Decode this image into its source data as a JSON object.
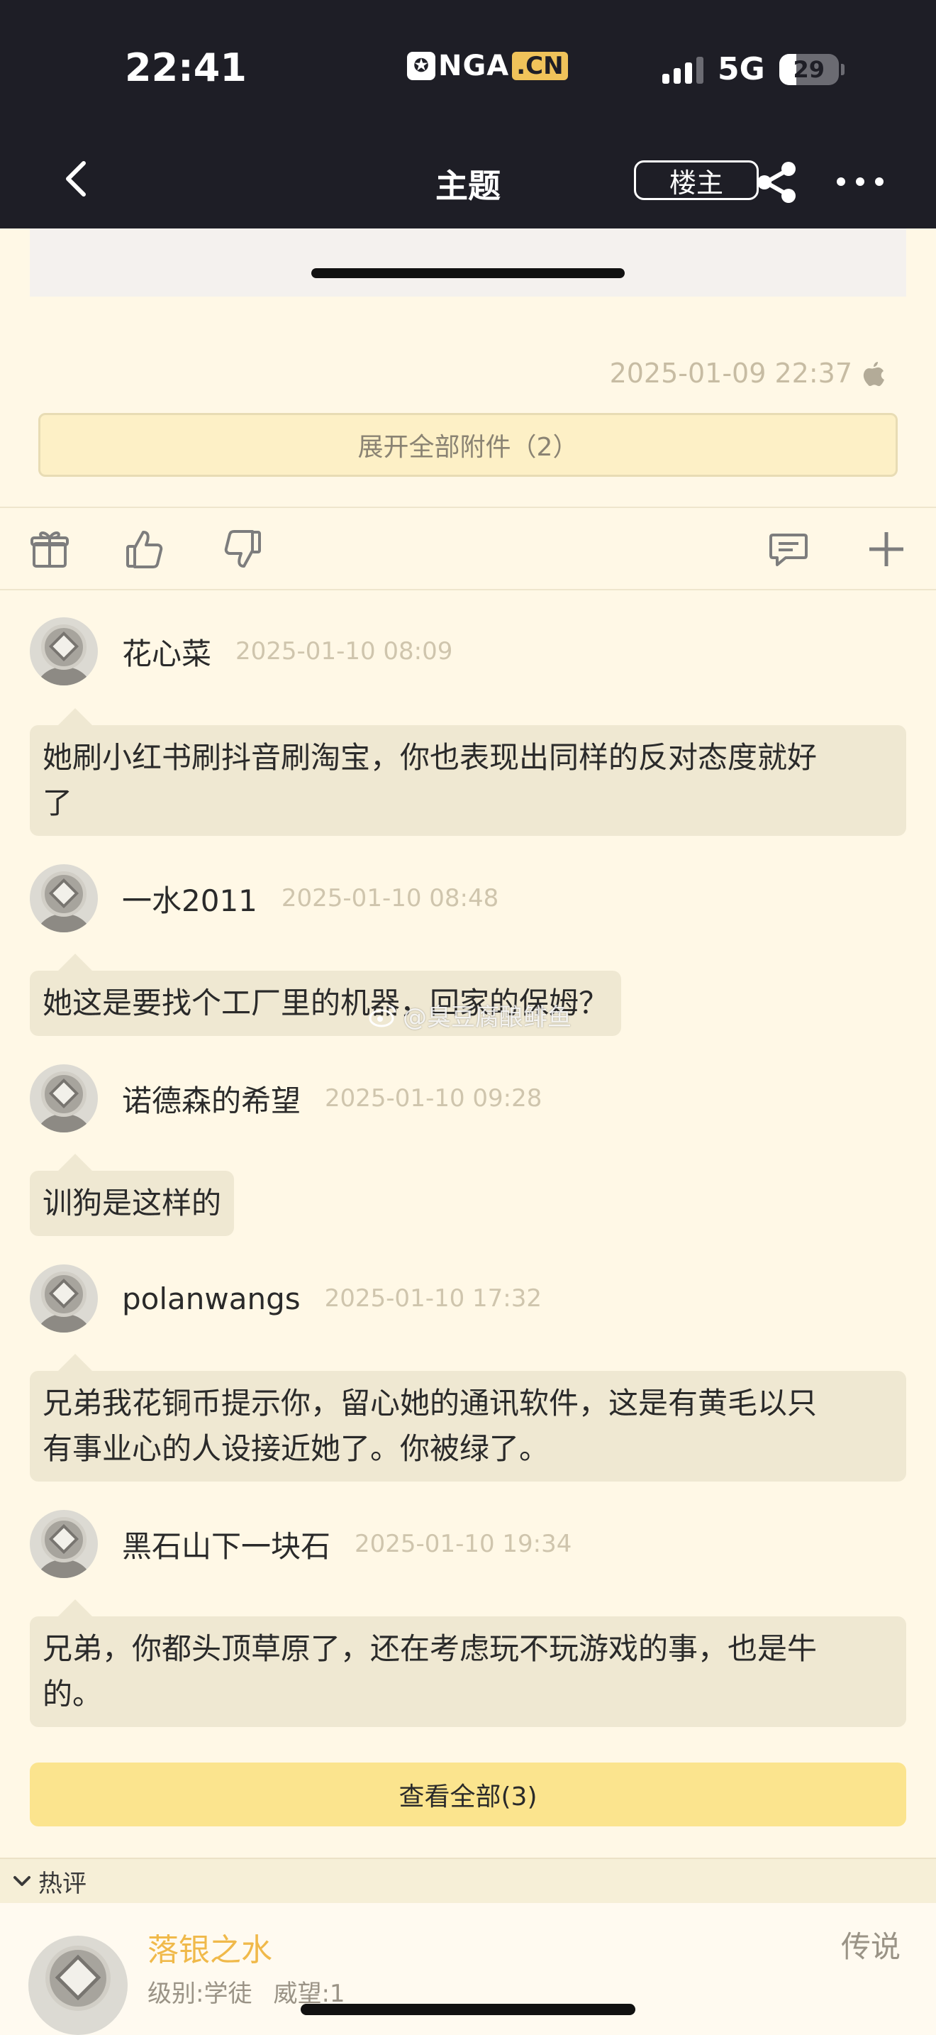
{
  "status_bar": {
    "time": "22:41",
    "logo_text": "NGA",
    "logo_cn": ".CN",
    "network": "5G",
    "battery": "29",
    "battery_level_percent": 29
  },
  "nav": {
    "title": "主题",
    "op_button": "楼主"
  },
  "post": {
    "timestamp": "2025-01-09 22:37",
    "expand_attachments": "展开全部附件（2）"
  },
  "replies": [
    {
      "user": "花心菜",
      "time": "2025-01-10 08:09",
      "lines": [
        "她刷小红书刷抖音刷淘宝，你也表现出同样的反对态度就好",
        "了"
      ]
    },
    {
      "user": "一水2011",
      "time": "2025-01-10 08:48",
      "lines": [
        "她这是要找个工厂里的机器，回家的保姆？"
      ]
    },
    {
      "user": "诺德森的希望",
      "time": "2025-01-10 09:28",
      "lines": [
        "训狗是这样的"
      ]
    },
    {
      "user": "polanwangs",
      "time": "2025-01-10 17:32",
      "lines": [
        "兄弟我花铜币提示你，留心她的通讯软件，这是有黄毛以只",
        "有事业心的人设接近她了。你被绿了。"
      ]
    },
    {
      "user": "黑石山下一块石",
      "time": "2025-01-10 19:34",
      "lines": [
        "兄弟，你都头顶草原了，还在考虑玩不玩游戏的事，也是牛",
        "的。"
      ]
    }
  ],
  "watermark": "@臭豆腐酿鲱鱼",
  "view_all": "查看全部(3)",
  "hot_section": {
    "label": "热评"
  },
  "hot_user": {
    "name": "落银之水",
    "level": "级别:学徒",
    "prestige": "威望:1",
    "rank": "传说"
  },
  "colors": {
    "nav_bg": "#1e1e26",
    "page_bg": "#fff8e6",
    "bubble": "#efe8d2",
    "accent_yellow": "#fbe48e",
    "hot_name": "#f0b94a"
  }
}
